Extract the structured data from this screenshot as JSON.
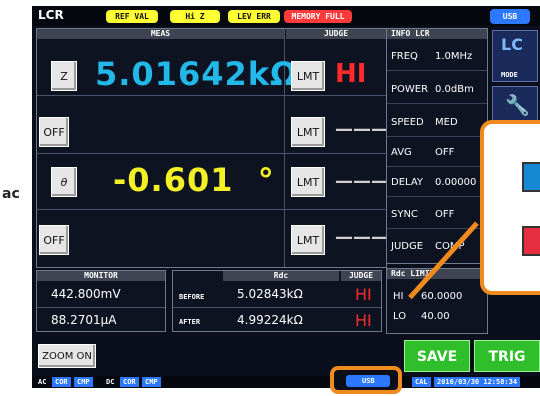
{
  "topbar": {
    "title": "LCR",
    "pills": [
      {
        "label": "REF VAL",
        "color": "#ffff33"
      },
      {
        "label": "Hi Z",
        "color": "#ffff33"
      },
      {
        "label": "LEV ERR",
        "color": "#ffff33"
      },
      {
        "label": "MEMORY FULL",
        "color": "#ff3a3a"
      }
    ],
    "usb": "USB"
  },
  "meas": {
    "header": "MEAS",
    "judge_header": "JUDGE",
    "rows": [
      {
        "param": "Z",
        "value": "5.01642kΩ",
        "value_color": "#22b8e8",
        "judge_btn": "LMT",
        "judge": "HI"
      },
      {
        "param": "OFF",
        "value": "",
        "judge_btn": "LMT",
        "judge": "———"
      },
      {
        "param": "θ",
        "value": "-0.601  °",
        "value_color": "#f3f126",
        "judge_btn": "LMT",
        "judge": "———"
      },
      {
        "param": "OFF",
        "value": "",
        "judge_btn": "LMT",
        "judge": "———"
      }
    ]
  },
  "info": {
    "header": "INFO LCR",
    "rows": [
      {
        "key": "FREQ",
        "value": "1.0MHz"
      },
      {
        "key": "POWER",
        "value": "0.0dBm"
      },
      {
        "key": "SPEED",
        "value": "MED"
      },
      {
        "key": "AVG",
        "value": "OFF"
      },
      {
        "key": "DELAY",
        "value": "0.00000"
      },
      {
        "key": "SYNC",
        "value": "OFF"
      },
      {
        "key": "JUDGE",
        "value": "COMP"
      }
    ]
  },
  "side": {
    "mode_label": "MODE",
    "logo": "LC"
  },
  "monitor": {
    "header": "MONITOR",
    "values": [
      "442.800mV",
      "88.2701μA"
    ]
  },
  "rdc": {
    "header": "Rdc",
    "judge_header": "JUDGE",
    "rows": [
      {
        "label": "BEFORE",
        "value": "5.02843kΩ",
        "judge": "HI"
      },
      {
        "label": "AFTER",
        "value": "4.99224kΩ",
        "judge": "HI"
      }
    ]
  },
  "rdc_limit": {
    "header": "Rdc LIMIT",
    "hi_label": "HI",
    "hi_value": "60.0000",
    "lo_label": "LO",
    "lo_value": "40.00"
  },
  "buttons": {
    "zoom": "ZOOM ON",
    "save": "SAVE",
    "trig": "TRIG"
  },
  "statusbar": {
    "ac": "AC",
    "dc": "DC",
    "cor": "COR",
    "cmp": "CMP",
    "usb": "USB",
    "cal": "CAL",
    "datetime": "2016/03/30 12:58:34"
  },
  "left_fragment": "ac"
}
